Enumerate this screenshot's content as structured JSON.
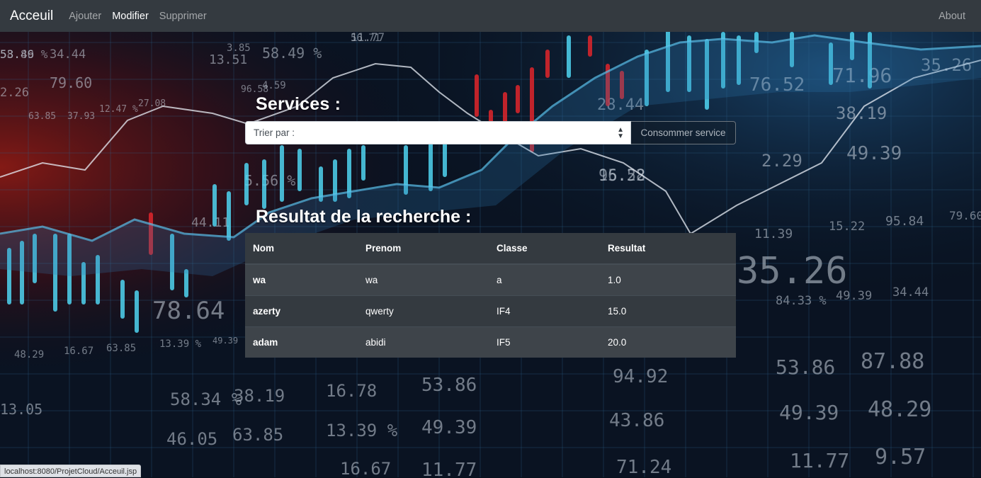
{
  "nav": {
    "brand": "Acceuil",
    "links": [
      "Ajouter",
      "Modifier",
      "Supprimer"
    ],
    "about": "About"
  },
  "services": {
    "heading": "Services :",
    "select_value": "Trier par :",
    "button_label": "Consommer service"
  },
  "results": {
    "heading": "Resultat de la recherche :",
    "columns": [
      "Nom",
      "Prenom",
      "Classe",
      "Resultat"
    ],
    "rows": [
      [
        "wa",
        "wa",
        "a",
        "1.0"
      ],
      [
        "azerty",
        "qwerty",
        "IF4",
        "15.0"
      ],
      [
        "adam",
        "abidi",
        "IF5",
        "20.0"
      ]
    ]
  },
  "status_bar": "localhost:8080/ProjetCloud/Acceuil.jsp",
  "background_numbers": [
    "53.86",
    "34.44",
    "58.49 %",
    "13.51",
    "11.77",
    "2.26",
    "79.60",
    "63.85",
    "37.93",
    "12.47 %",
    "27.08",
    "4.59",
    "96.58",
    "15.22",
    "44.11",
    "5.56 %",
    "56.71",
    "35.26",
    "76.52",
    "71.96",
    "38.19",
    "2.29",
    "49.39",
    "28.44",
    "96.58",
    "15.22",
    "95.84",
    "79.60",
    "11.39",
    "78.64",
    "35.26",
    "84.33 %",
    "49.39",
    "34.44",
    "48.29",
    "16.67",
    "63.85",
    "13.39 %",
    "49.39",
    "38.19",
    "58.34 %",
    "16.78",
    "53.86",
    "94.92",
    "53.86",
    "87.88",
    "46.05",
    "63.85",
    "13.39 %",
    "49.39",
    "43.86",
    "49.39",
    "48.29",
    "16.67",
    "11.77",
    "71.24",
    "11.77",
    "9.57",
    "13.05",
    "3.85",
    "58.49 %"
  ],
  "colors": {
    "navbar": "#343a40",
    "table_dark": "#343a40",
    "table_stripe": "#3e444a",
    "accent_cyan": "#4fd3f0",
    "accent_red": "#e0262b"
  }
}
